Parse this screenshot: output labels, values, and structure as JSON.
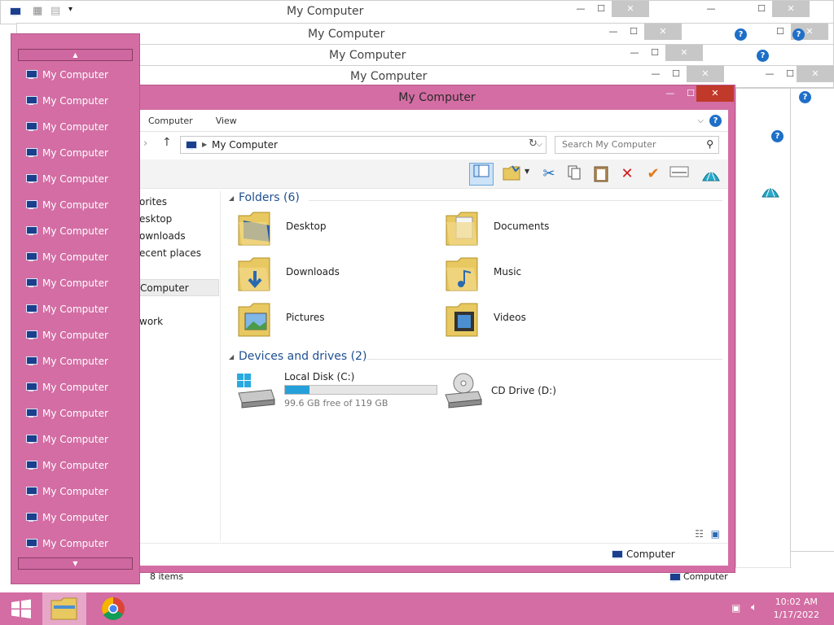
{
  "window_title": "My Computer",
  "background_windows": [
    {
      "title": "My Computer"
    },
    {
      "title": "My Computer"
    },
    {
      "title": "My Computer"
    },
    {
      "title": "My Computer"
    }
  ],
  "ribbon": {
    "tabs": [
      "Computer",
      "View"
    ],
    "help": "?"
  },
  "address": {
    "path": "My Computer",
    "search_placeholder": "Search My Computer"
  },
  "nav_pane": {
    "items": [
      "orites",
      "esktop",
      "ownloads",
      "ecent places",
      "Computer",
      "work"
    ]
  },
  "folders_group": {
    "title": "Folders (6)",
    "items": [
      "Desktop",
      "Documents",
      "Downloads",
      "Music",
      "Pictures",
      "Videos"
    ]
  },
  "devices_group": {
    "title": "Devices and drives (2)",
    "drives": [
      {
        "name": "Local Disk (C:)",
        "free_text": "99.6 GB free of 119 GB",
        "used_fraction": 0.163
      },
      {
        "name": "CD Drive (D:)"
      }
    ]
  },
  "status": {
    "main_location": "Computer",
    "back_items": "8 items",
    "back_location": "Computer"
  },
  "jumplist": {
    "items": [
      "My Computer",
      "My Computer",
      "My Computer",
      "My Computer",
      "My Computer",
      "My Computer",
      "My Computer",
      "My Computer",
      "My Computer",
      "My Computer",
      "My Computer",
      "My Computer",
      "My Computer",
      "My Computer",
      "My Computer",
      "My Computer",
      "My Computer",
      "My Computer",
      "My Computer"
    ],
    "scroll_up": "▲",
    "scroll_down": "▼"
  },
  "taskbar": {
    "time": "10:02 AM",
    "date": "1/17/2022"
  },
  "colors": {
    "accent_pink": "#d36da3",
    "folder_yellow": "#e8c860",
    "link_blue": "#1e4f91",
    "progress_blue": "#26a0da"
  }
}
